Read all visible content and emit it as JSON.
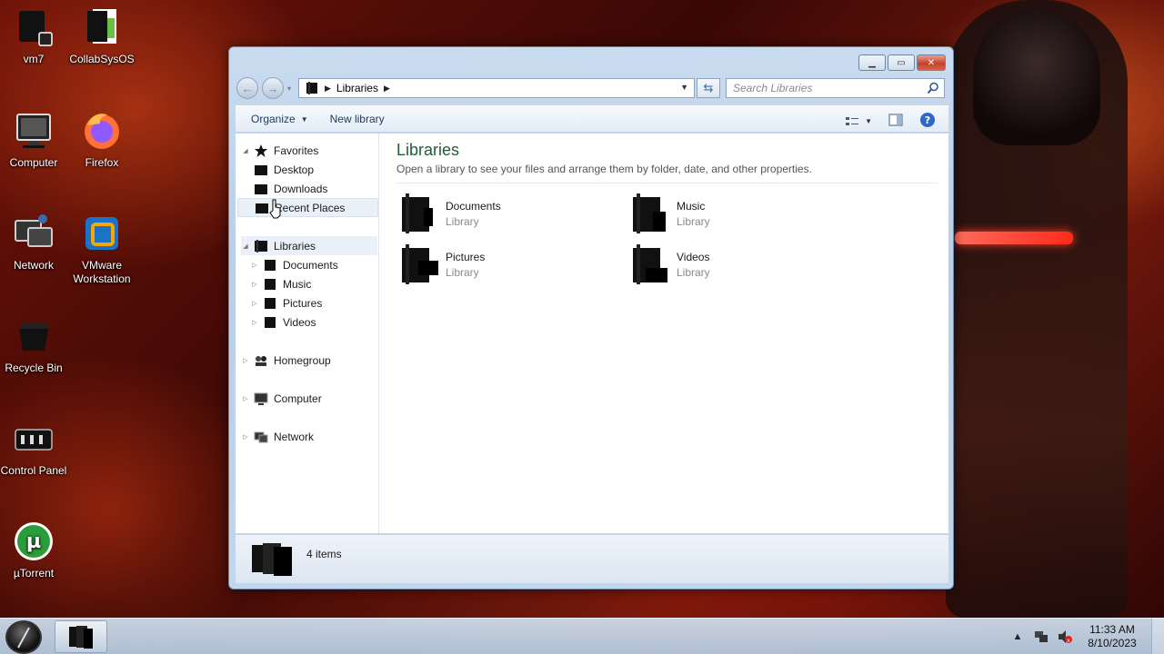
{
  "desktop": {
    "icons": [
      {
        "label": "vm7",
        "icon": "vm-icon"
      },
      {
        "label": "CollabSysOS",
        "icon": "document-icon"
      },
      {
        "label": "Computer",
        "icon": "computer-icon"
      },
      {
        "label": "Firefox",
        "icon": "firefox-icon"
      },
      {
        "label": "Network",
        "icon": "network-icon"
      },
      {
        "label": "VMware Workstation",
        "icon": "vmware-icon"
      },
      {
        "label": "Recycle Bin",
        "icon": "recycle-bin-icon"
      },
      {
        "label": "Control Panel",
        "icon": "control-panel-icon"
      },
      {
        "label": "µTorrent",
        "icon": "utorrent-icon"
      }
    ]
  },
  "window": {
    "address": {
      "crumb": "Libraries"
    },
    "search": {
      "placeholder": "Search Libraries"
    },
    "toolbar": {
      "organize": "Organize",
      "new_library": "New library"
    },
    "nav": {
      "favorites": "Favorites",
      "desktop": "Desktop",
      "downloads": "Downloads",
      "recent_places": "Recent Places",
      "libraries": "Libraries",
      "documents": "Documents",
      "music": "Music",
      "pictures": "Pictures",
      "videos": "Videos",
      "homegroup": "Homegroup",
      "computer": "Computer",
      "network": "Network"
    },
    "main": {
      "title": "Libraries",
      "description": "Open a library to see your files and arrange them by folder, date, and other properties.",
      "items": [
        {
          "name": "Documents",
          "type": "Library"
        },
        {
          "name": "Music",
          "type": "Library"
        },
        {
          "name": "Pictures",
          "type": "Library"
        },
        {
          "name": "Videos",
          "type": "Library"
        }
      ]
    },
    "details": {
      "count": "4 items"
    }
  },
  "taskbar": {
    "time": "11:33 AM",
    "date": "8/10/2023"
  },
  "colors": {
    "accent_title": "#1e5e38",
    "close_button": "#c7412b"
  }
}
